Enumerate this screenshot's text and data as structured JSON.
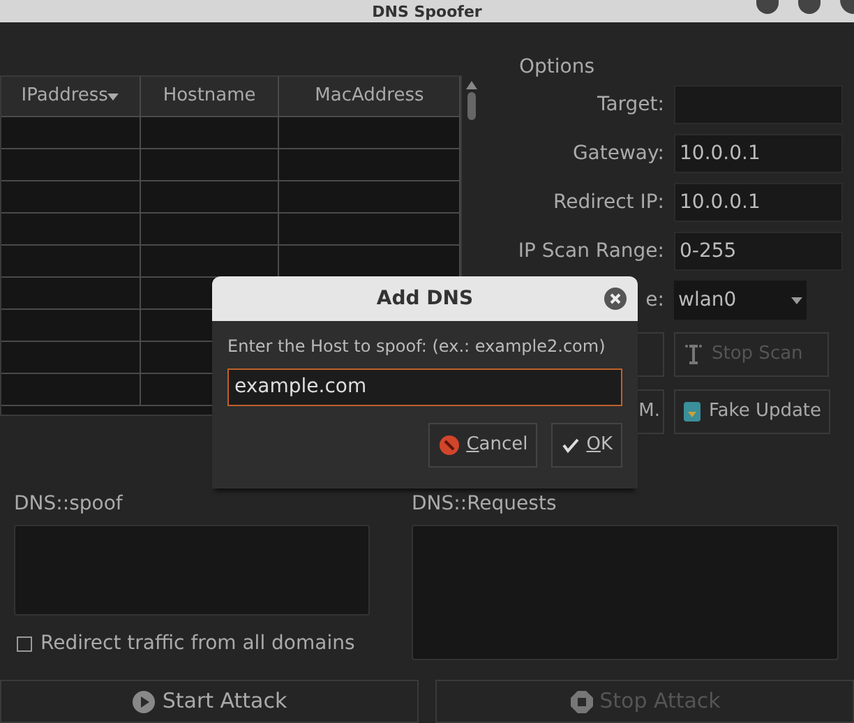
{
  "window": {
    "title": "DNS Spoofer"
  },
  "host_table": {
    "columns": [
      {
        "label": "IPaddress",
        "sorted": true
      },
      {
        "label": "Hostname",
        "sorted": false
      },
      {
        "label": "MacAddress",
        "sorted": false
      }
    ]
  },
  "options": {
    "title": "Options",
    "fields": [
      {
        "label": "Target:",
        "kind": "text"
      },
      {
        "label": "Gateway:",
        "value": "10.0.0.1",
        "kind": "text"
      },
      {
        "label": "Redirect IP:",
        "value": "10.0.0.1",
        "kind": "text"
      },
      {
        "label": "IP Scan Range:",
        "value": "0-255",
        "kind": "text"
      },
      {
        "label": "e:",
        "value": "wlan0",
        "kind": "select"
      }
    ],
    "buttons": [
      {
        "label": "Stop Scan",
        "kind": "scan",
        "disabled": true
      },
      {
        "left_label": "M.",
        "label": "Fake Update",
        "kind": "update",
        "disabled": false
      }
    ]
  },
  "spoof": {
    "title": "DNS::spoof",
    "checkbox": {
      "label": "Redirect traffic from all domains",
      "checked": false
    }
  },
  "requests": {
    "title": "DNS::Requests"
  },
  "actions": [
    {
      "label": "Start Attack",
      "kind": "start",
      "disabled": false
    },
    {
      "label": "Stop Attack",
      "kind": "stop",
      "disabled": true
    }
  ],
  "dialog": {
    "title": "Add DNS",
    "prompt": "Enter the Host to spoof: (ex.: example2.com)",
    "input": {
      "value": "example.com",
      "focused": true
    },
    "buttons": [
      {
        "label": "Cancel",
        "kind": "cancel",
        "mnemonic": true
      },
      {
        "label": "OK",
        "kind": "ok",
        "mnemonic": true
      }
    ]
  }
}
